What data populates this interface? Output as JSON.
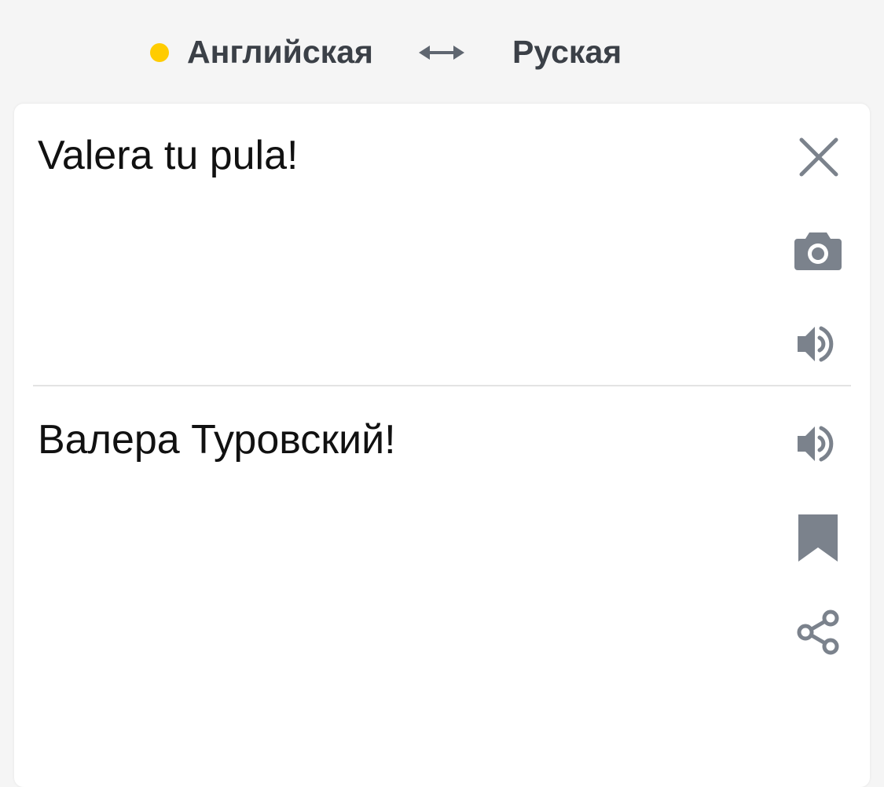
{
  "languages": {
    "source": "Английская",
    "target": "Руская"
  },
  "input": {
    "text": "Valera tu pula!"
  },
  "output": {
    "text": "Валера Туровский!"
  },
  "icons": {
    "clear": "close-icon",
    "camera": "camera-icon",
    "speak_source": "speaker-icon",
    "speak_target": "speaker-icon",
    "bookmark": "bookmark-icon",
    "share": "share-icon",
    "swap": "swap-arrows-icon"
  },
  "colors": {
    "accent_dot": "#ffcc00",
    "icon": "#7b828c",
    "text": "#111111",
    "lang_text": "#3b4047"
  }
}
